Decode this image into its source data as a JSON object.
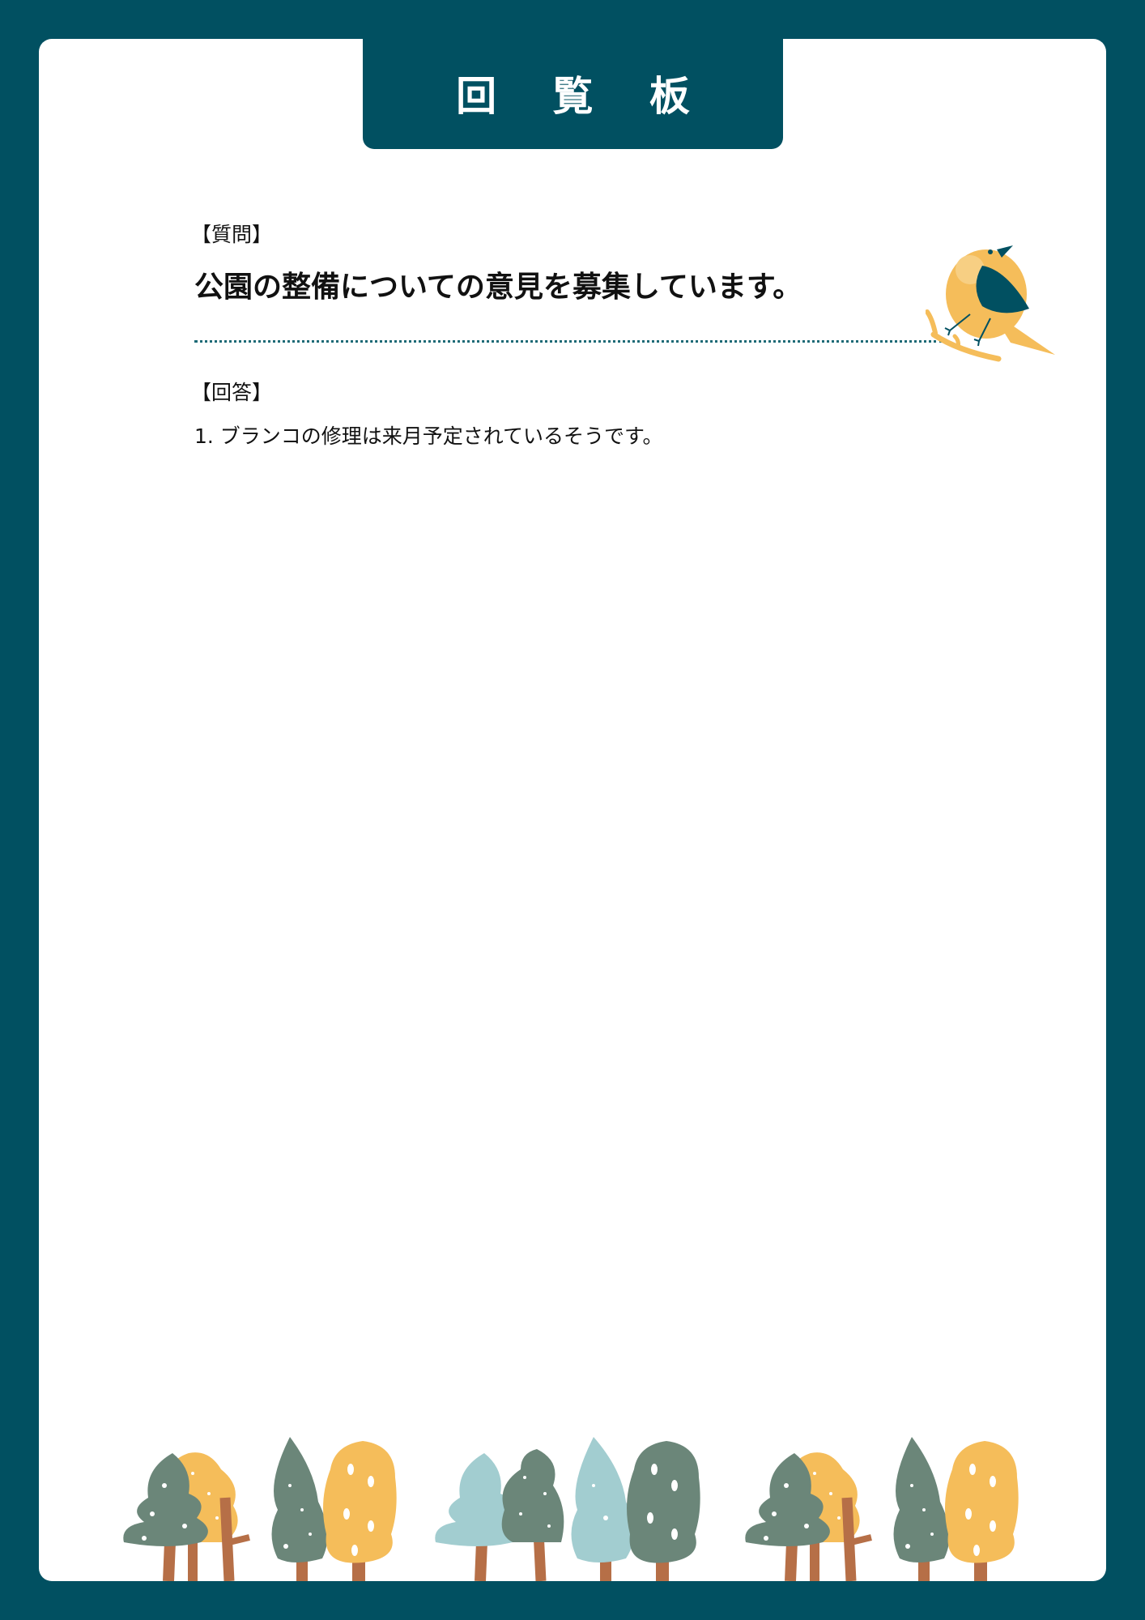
{
  "board": {
    "title": "回 覧 板"
  },
  "question": {
    "label": "【質問】",
    "text": "公園の整備についての意見を募集しています。"
  },
  "answer": {
    "label": "【回答】",
    "items": [
      "1. ブランコの修理は来月予定されているそうです。"
    ]
  },
  "colors": {
    "frame": "#015061",
    "paper": "#ffffff",
    "tree_gray": "#6b8679",
    "tree_yellow": "#f5bd5a",
    "tree_light": "#a2cdd0",
    "trunk": "#b66f47",
    "bird_body": "#f5bd5a",
    "bird_wing": "#015061"
  },
  "illustrations": {
    "top_right": "bird-on-branch-icon",
    "bottom": "forest-trees-illustration"
  }
}
